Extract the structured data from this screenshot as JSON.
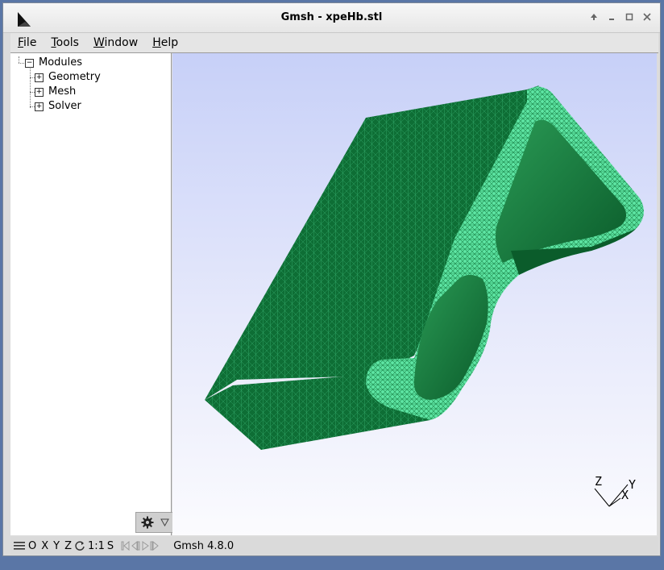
{
  "window": {
    "title": "Gmsh - xpeHb.stl"
  },
  "menu": {
    "items": [
      {
        "label": "File",
        "underline": "F",
        "rest": "ile"
      },
      {
        "label": "Tools",
        "underline": "T",
        "rest": "ools"
      },
      {
        "label": "Window",
        "underline": "W",
        "rest": "indow"
      },
      {
        "label": "Help",
        "underline": "H",
        "rest": "elp"
      }
    ]
  },
  "tree": {
    "root": {
      "label": "Modules",
      "expanded": true
    },
    "children": [
      {
        "label": "Geometry",
        "expanded": false
      },
      {
        "label": "Mesh",
        "expanded": false
      },
      {
        "label": "Solver",
        "expanded": false
      }
    ]
  },
  "status": {
    "menu_icon": "hamburger-icon",
    "o": "O",
    "x": "X",
    "y": "Y",
    "z": "Z",
    "rotate_icon": "rotate-icon",
    "scale": "1:1",
    "s": "S",
    "message": "Gmsh 4.8.0"
  },
  "axes": {
    "z": "Z",
    "y": "Y",
    "x": "X"
  },
  "colors": {
    "mesh_fill": "#0f7a3a",
    "mesh_edges": "#5ee6a4",
    "viewport_top": "#c7d0f8",
    "viewport_bottom": "#fbfbfe"
  },
  "icons": {
    "app": "gmsh-logo-icon",
    "gear": "gear-icon",
    "dropdown": "triangle-down-icon"
  }
}
